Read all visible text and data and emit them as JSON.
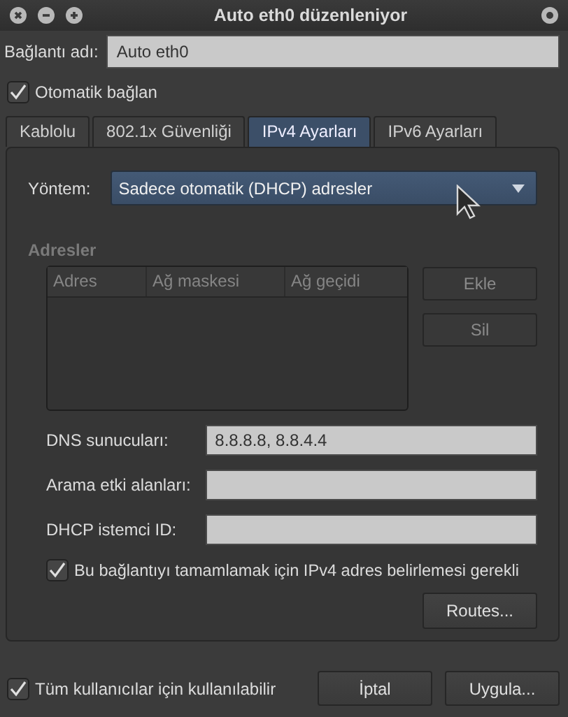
{
  "window": {
    "title": "Auto eth0 düzenleniyor"
  },
  "connection_name": {
    "label": "Bağlantı adı:",
    "value": "Auto eth0"
  },
  "auto_connect": {
    "label": "Otomatik bağlan",
    "checked": true
  },
  "tabs": [
    {
      "label": "Kablolu",
      "selected": false
    },
    {
      "label": "802.1x Güvenliği",
      "selected": false
    },
    {
      "label": "IPv4 Ayarları",
      "selected": true
    },
    {
      "label": "IPv6 Ayarları",
      "selected": false
    }
  ],
  "method": {
    "label": "Yöntem:",
    "value": "Sadece otomatik (DHCP) adresler"
  },
  "addresses": {
    "title": "Adresler",
    "disabled": true,
    "columns": [
      "Adres",
      "Ağ maskesi",
      "Ağ geçidi"
    ],
    "buttons": [
      {
        "label": "Ekle",
        "disabled": true
      },
      {
        "label": "Sil",
        "disabled": true
      }
    ]
  },
  "fields": [
    {
      "label": "DNS sunucuları:",
      "value": "8.8.8.8, 8.8.4.4"
    },
    {
      "label": "Arama etki alanları:"
    },
    {
      "label": "DHCP istemci ID:"
    }
  ],
  "require_ipv4": {
    "label": "Bu bağlantıyı tamamlamak için IPv4 adres belirlemesi gerekli",
    "checked": true
  },
  "routes_button": "Routes...",
  "all_users": {
    "label": "Tüm kullanıcılar için kullanılabilir",
    "checked": true
  },
  "buttons": [
    "İptal",
    "Uygula..."
  ]
}
